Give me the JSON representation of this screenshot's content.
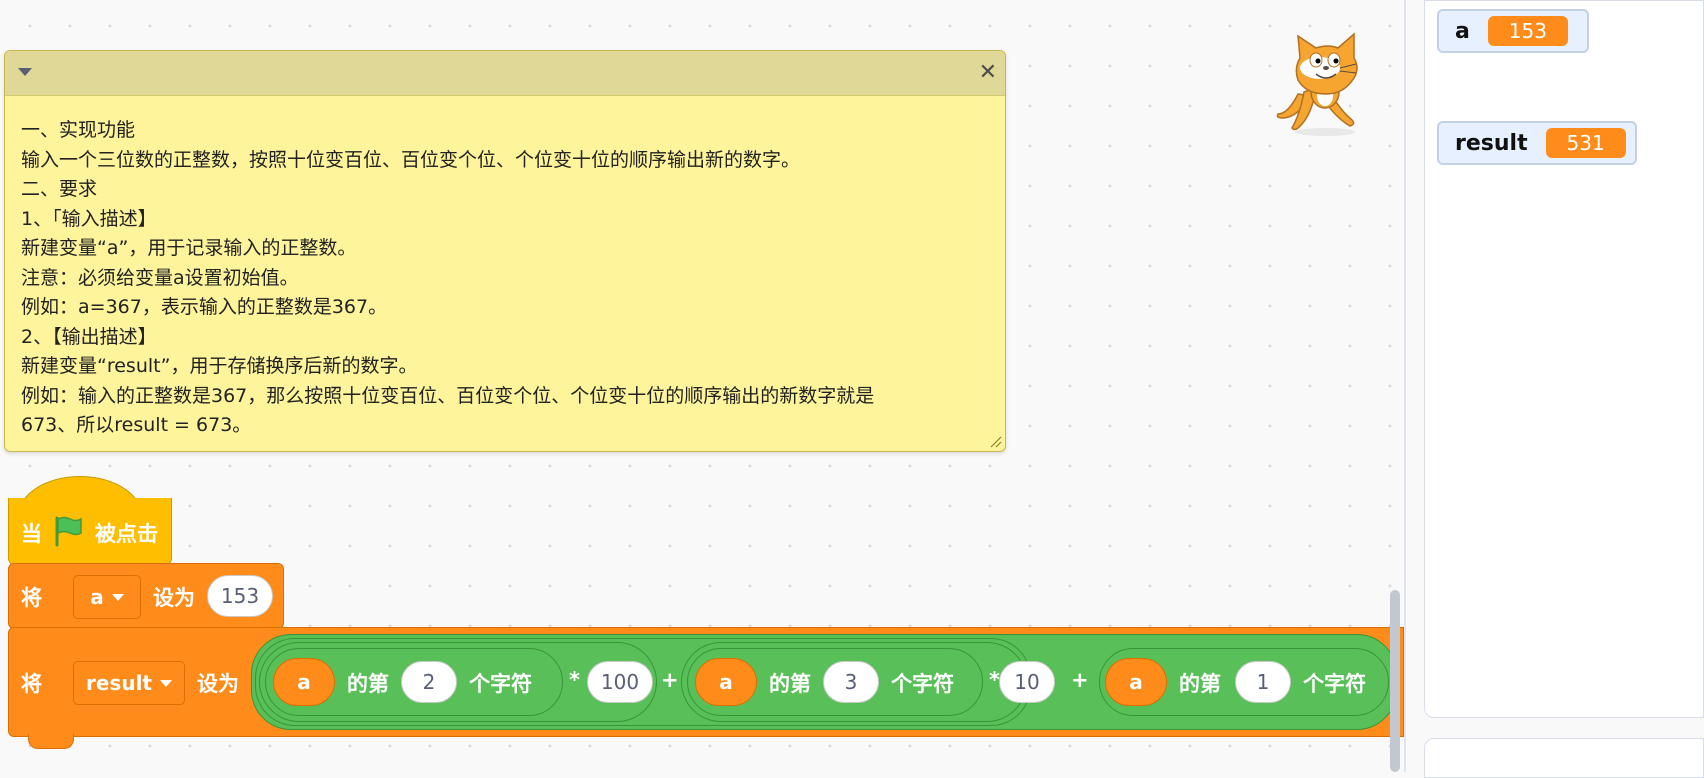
{
  "comment": {
    "lines": [
      "一、实现功能",
      "输入一个三位数的正整数，按照十位变百位、百位变个位、个位变十位的顺序输出新的数字。",
      "二、要求",
      "1、「输入描述】",
      "新建变量“a”，用于记录输入的正整数。",
      "注意：必须给变量a设置初始值。",
      "例如：a=367，表示输入的正整数是367。",
      "2、【输出描述】",
      "新建变量“result”，用于存储换序后新的数字。",
      "例如：输入的正整数是367，那么按照十位变百位、百位变个位、个位变十位的顺序输出的新数字就是",
      "673、所以result = 673。"
    ]
  },
  "blocks": {
    "hat": {
      "prefix": "当",
      "suffix": "被点击",
      "flag_icon": "green-flag-icon"
    },
    "set_a": {
      "verb": "将",
      "variable": "a",
      "to": "设为",
      "value": "153"
    },
    "set_result": {
      "verb": "将",
      "variable": "result",
      "to": "设为",
      "terms": [
        {
          "var": "a",
          "of": "的第",
          "index": "2",
          "char": "个字符",
          "op": "*",
          "mult": "100"
        },
        {
          "var": "a",
          "of": "的第",
          "index": "3",
          "char": "个字符",
          "op": "*",
          "mult": "10"
        },
        {
          "var": "a",
          "of": "的第",
          "index": "1",
          "char": "个字符"
        }
      ],
      "plus": "+"
    }
  },
  "monitors": [
    {
      "label": "a",
      "value": "153"
    },
    {
      "label": "result",
      "value": "531"
    }
  ],
  "colors": {
    "event": "#ffbf00",
    "variable": "#ff8c1a",
    "operator": "#59c059",
    "comment": "#fef49c",
    "monitor_bg": "#e6f0ff"
  }
}
